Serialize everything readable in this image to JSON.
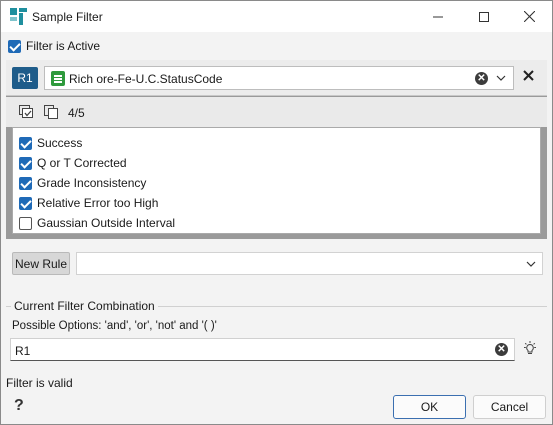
{
  "window": {
    "title": "Sample Filter"
  },
  "filter_active": {
    "label": "Filter is Active",
    "checked": true
  },
  "rule": {
    "badge": "R1",
    "selected": "Rich ore-Fe-U.C.StatusCode",
    "count": "4/5",
    "items": [
      {
        "label": "Success",
        "checked": true
      },
      {
        "label": "Q or T Corrected",
        "checked": true
      },
      {
        "label": "Grade Inconsistency",
        "checked": true
      },
      {
        "label": "Relative Error too High",
        "checked": true
      },
      {
        "label": "Gaussian Outside Interval",
        "checked": false
      }
    ]
  },
  "new_rule": {
    "button_label": "New Rule",
    "value": ""
  },
  "combination": {
    "title": "Current Filter Combination",
    "hint": "Possible Options: 'and', 'or', 'not' and '( )'",
    "value": "R1"
  },
  "status": "Filter is valid",
  "buttons": {
    "help": "?",
    "ok": "OK",
    "cancel": "Cancel"
  },
  "icons": {
    "app": "app-logo-icon",
    "rule_type": "list-document-icon",
    "select_all": "select-all-icon",
    "copy": "copy-icon",
    "suggest": "lightbulb-icon"
  },
  "colors": {
    "accent": "#1f6ab7",
    "badge": "#1e5c8a",
    "rule_icon": "#2e9a3c"
  }
}
